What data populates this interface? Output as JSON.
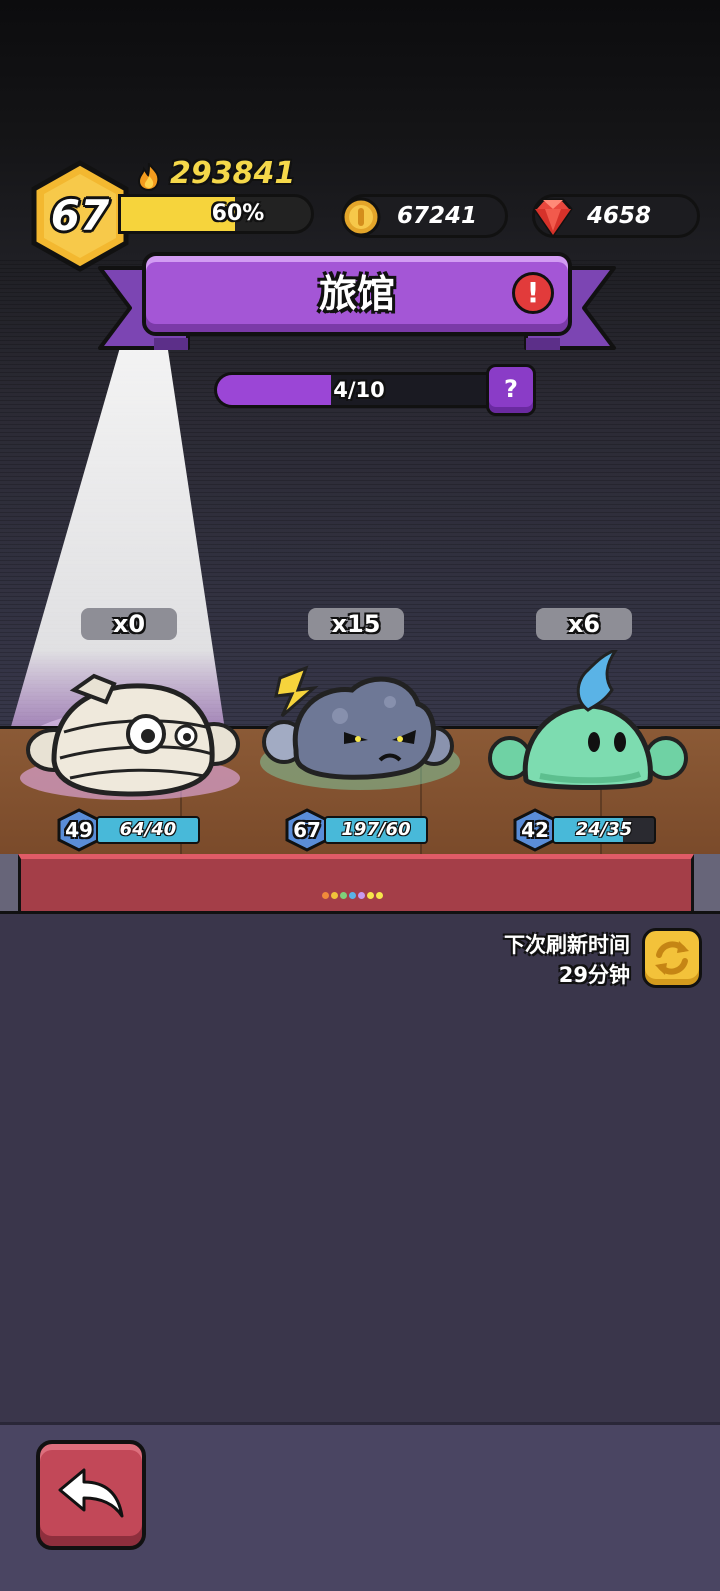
{
  "player": {
    "level": "67",
    "power": "293841",
    "xp_percent_label": "60%",
    "xp_fraction": 0.6
  },
  "resources": {
    "coins": "67241",
    "gems": "4658"
  },
  "header": {
    "title": "旅馆",
    "alert_icon": "!",
    "progress_label": "4/10",
    "progress_fraction": 0.4,
    "help_label": "?"
  },
  "creatures": [
    {
      "name": "mummy",
      "count": "x0",
      "level": "49",
      "hp": "64/40",
      "hp_fraction": 1.0
    },
    {
      "name": "storm-cloud",
      "count": "x15",
      "level": "67",
      "hp": "197/60",
      "hp_fraction": 1.0
    },
    {
      "name": "slime",
      "count": "x6",
      "level": "42",
      "hp": "24/35",
      "hp_fraction": 0.69
    }
  ],
  "refresh": {
    "line1": "下次刷新时间",
    "line2": "29分钟"
  },
  "colors": {
    "accent_purple": "#a456d6",
    "gold": "#f5d84a",
    "hp_blue": "#48b9d9",
    "back_red": "#c24858"
  }
}
